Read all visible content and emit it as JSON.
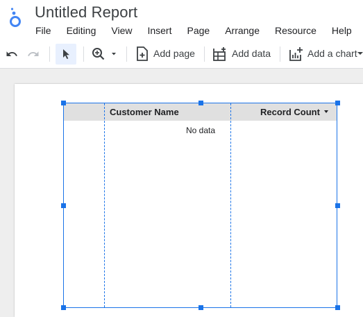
{
  "app": {
    "title": "Untitled Report",
    "logo_icon": "looker-studio-logo",
    "accent_color": "#1a73e8"
  },
  "menu": {
    "items": [
      "File",
      "Editing",
      "View",
      "Insert",
      "Page",
      "Arrange",
      "Resource",
      "Help"
    ]
  },
  "toolbar": {
    "undo_icon": "undo-icon",
    "redo_icon": "redo-icon",
    "select_icon": "cursor-icon",
    "zoom_icon": "zoom-icon",
    "add_page_label": "Add page",
    "add_data_label": "Add data",
    "add_chart_label": "Add a chart"
  },
  "table": {
    "columns": [
      "",
      "Customer Name",
      "Record Count"
    ],
    "empty_message": "No data",
    "sort_column": "Record Count",
    "sort_direction": "descending"
  }
}
